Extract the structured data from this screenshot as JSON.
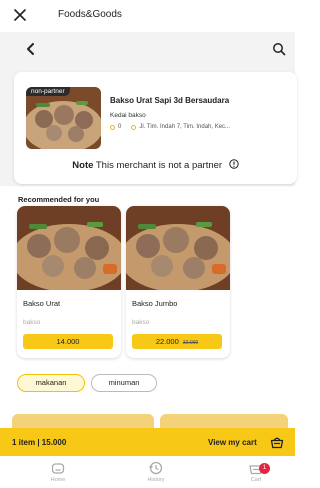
{
  "appbar": {
    "title": "Foods&Goods"
  },
  "merchant": {
    "badge": "non-partner",
    "name": "Bakso Urat Sapi 3d Bersaudara",
    "category": "Kedai bakso",
    "rating": "0",
    "address": "Jl. Tim. Indah 7, Tim. Indah, Kec...",
    "note_label": "Note",
    "note_text": "This merchant is not a partner"
  },
  "recommended": {
    "title": "Recommended for you",
    "items": [
      {
        "name": "Bakso Urat",
        "category": "bakso",
        "price": "14.000",
        "old_price": ""
      },
      {
        "name": "Bakso Jumbo",
        "category": "bakso",
        "price": "22.000",
        "old_price": "32.000"
      }
    ]
  },
  "categories": [
    {
      "label": "makanan",
      "active": true
    },
    {
      "label": "minuman",
      "active": false
    }
  ],
  "cart": {
    "summary": "1 item | 15.000",
    "view_label": "View my cart",
    "badge_count": "1"
  },
  "nav": {
    "home": "Home",
    "history": "History",
    "cart": "Cart"
  },
  "colors": {
    "accent": "#f7c816",
    "badge": "#e5243f"
  }
}
